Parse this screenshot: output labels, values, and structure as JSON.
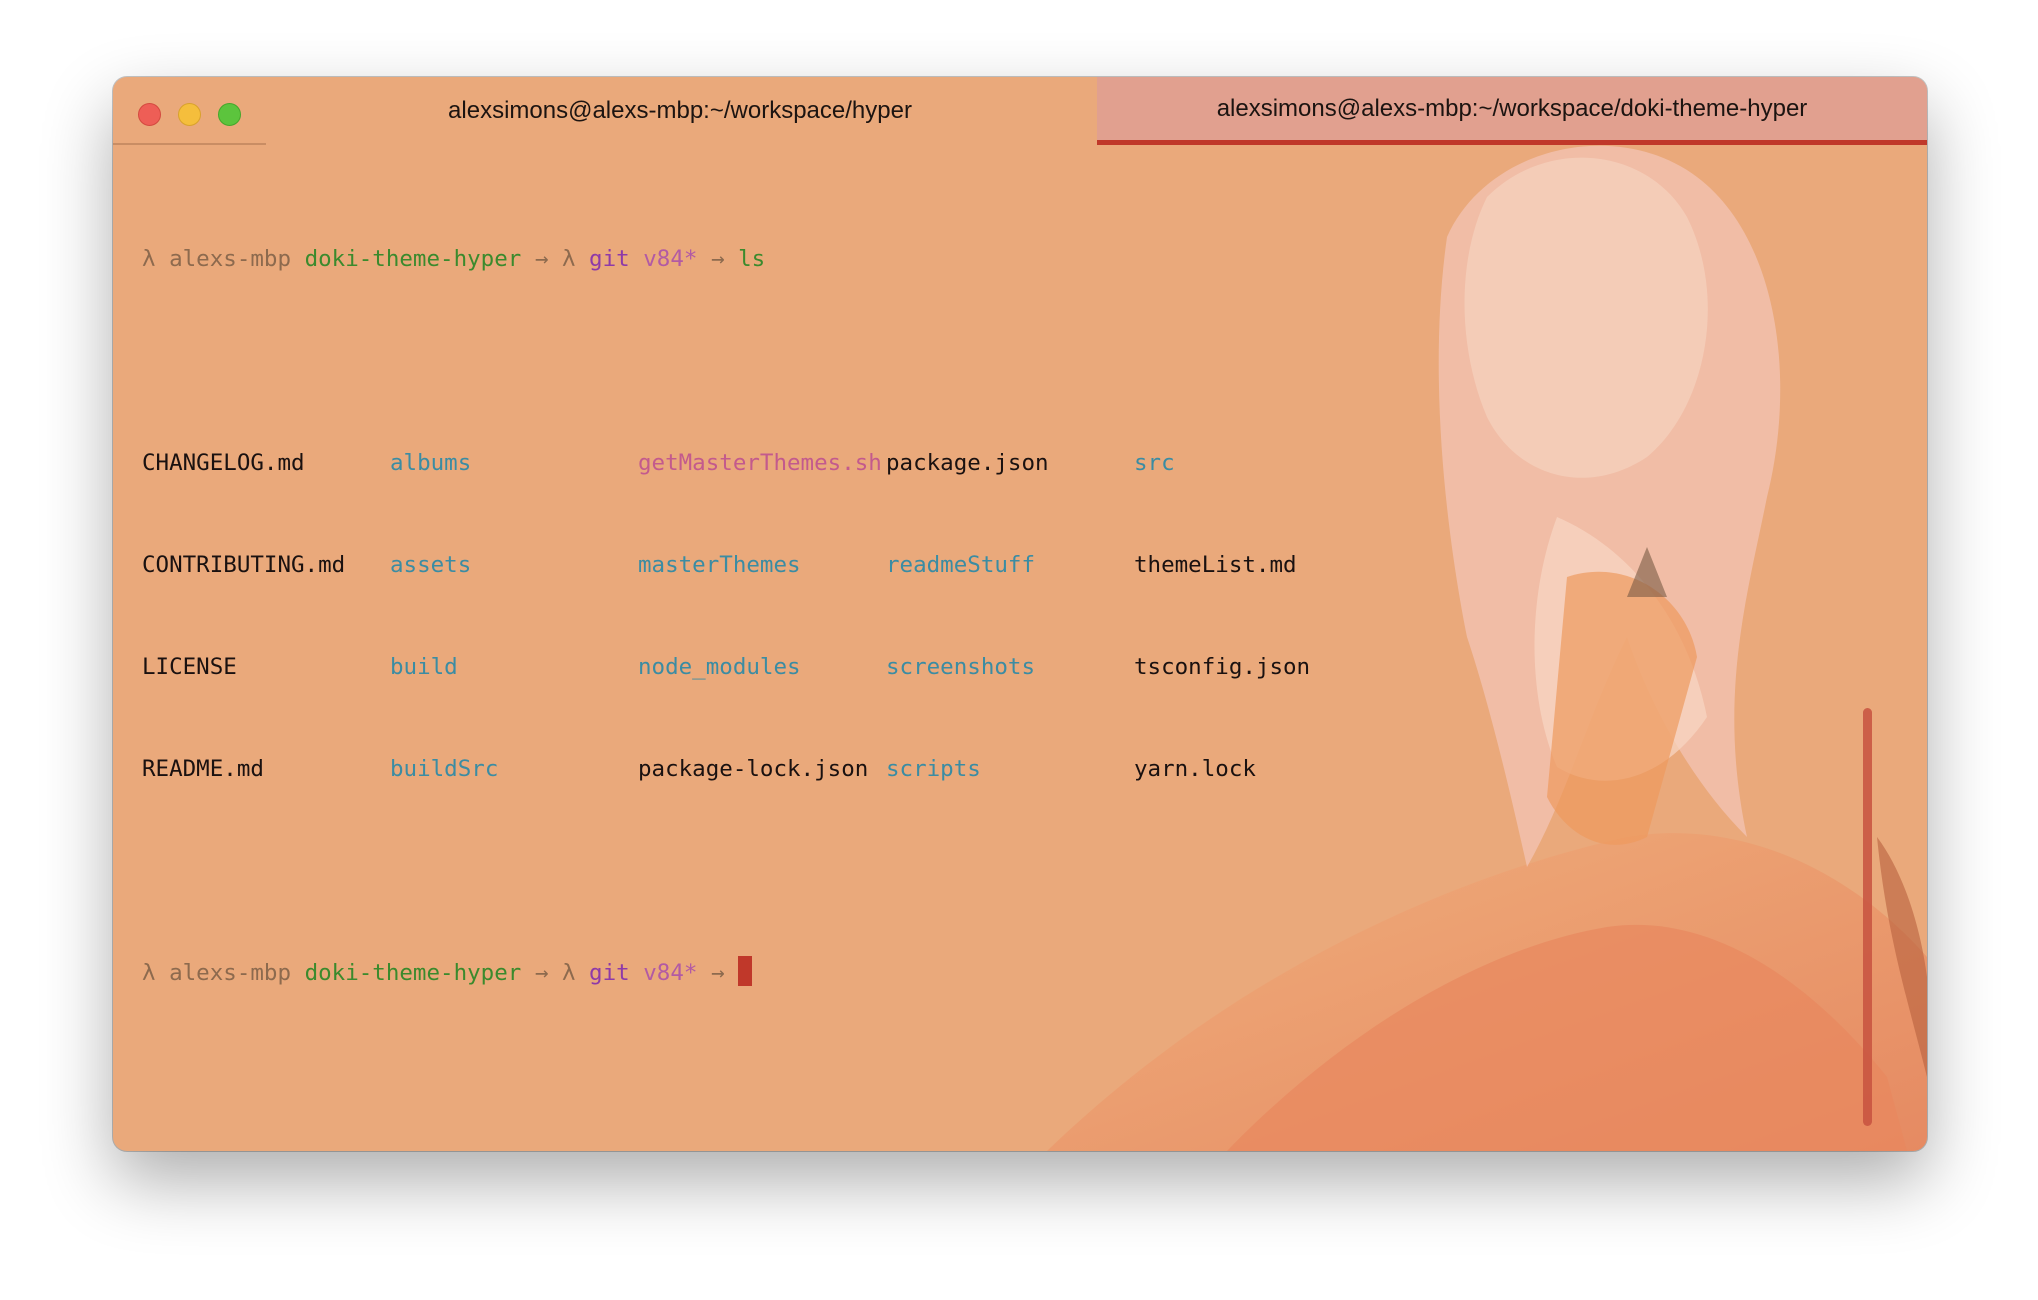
{
  "window": {
    "tabs": [
      {
        "label": "alexsimons@alexs-mbp:~/workspace/hyper",
        "active": false
      },
      {
        "label": "alexsimons@alexs-mbp:~/workspace/doki-theme-hyper",
        "active": true
      }
    ]
  },
  "prompt": {
    "lambda": "λ",
    "host": "alexs-mbp",
    "dir": "doki-theme-hyper",
    "arrow": "→",
    "git_lambda": "λ",
    "git": "git",
    "branch": "v84*"
  },
  "commands": {
    "first": "ls"
  },
  "listing": {
    "rows": [
      [
        "CHANGELOG.md",
        "albums",
        "getMasterThemes.sh",
        "package.json",
        "src"
      ],
      [
        "CONTRIBUTING.md",
        "assets",
        "masterThemes",
        "readmeStuff",
        "themeList.md"
      ],
      [
        "LICENSE",
        "build",
        "node_modules",
        "screenshots",
        "tsconfig.json"
      ],
      [
        "README.md",
        "buildSrc",
        "package-lock.json",
        "scripts",
        "yarn.lock"
      ]
    ]
  },
  "colors": {
    "background": "#eaa97b",
    "active_tab": "#e1a08f",
    "accent": "#c0382a",
    "directory": "#3b8ca3",
    "executable": "#c35a8d",
    "prompt_dir": "#3b8a2d"
  }
}
